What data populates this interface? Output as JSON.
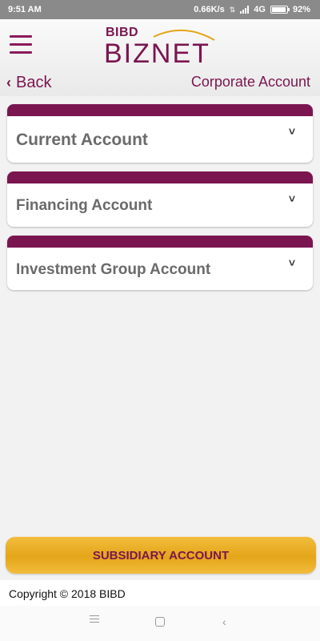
{
  "status_bar": {
    "time": "9:51 AM",
    "speed": "0.66K/s",
    "network": "4G",
    "battery": "92%",
    "battery_level": 0.92
  },
  "header": {
    "logo_small": "BIBD",
    "logo_big": "BIZNET",
    "back_label": "Back",
    "title": "Corporate Account"
  },
  "accounts": [
    {
      "label": "Current Account"
    },
    {
      "label": "Financing Account"
    },
    {
      "label": "Investment Group Account"
    }
  ],
  "subsidiary_button": "SUBSIDIARY ACCOUNT",
  "footer": "Copyright © 2018 BIBD",
  "colors": {
    "brand": "#7b1550",
    "accent": "#e4a519",
    "card_label": "#6a6a6a"
  }
}
